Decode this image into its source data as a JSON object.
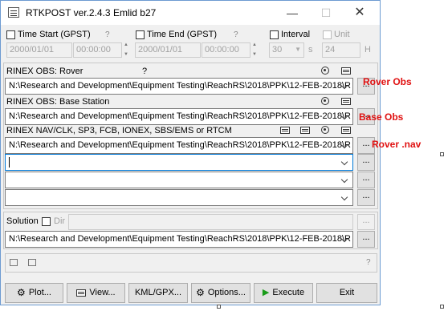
{
  "window": {
    "title": "RTKPOST ver.2.4.3 Emlid b27"
  },
  "time_start": {
    "label": "Time Start (GPST)",
    "date": "2000/01/01",
    "time": "00:00:00",
    "help": "?"
  },
  "time_end": {
    "label": "Time End (GPST)",
    "date": "2000/01/01",
    "time": "00:00:00",
    "help": "?"
  },
  "interval": {
    "label": "Interval",
    "value": "30",
    "unit_suffix": "s"
  },
  "unit": {
    "label": "Unit",
    "value": "24",
    "unit_suffix": "H"
  },
  "rinex_rover": {
    "label": "RINEX OBS: Rover",
    "help": "?",
    "path": "N:\\Research and Development\\Equipment Testing\\ReachRS\\2018\\PPK\\12-FEB-2018\\R"
  },
  "rinex_base": {
    "label": "RINEX OBS: Base Station",
    "path": "N:\\Research and Development\\Equipment Testing\\ReachRS\\2018\\PPK\\12-FEB-2018\\R"
  },
  "rinex_nav": {
    "label": "RINEX NAV/CLK, SP3, FCB, IONEX, SBS/EMS  or RTCM",
    "path": "N:\\Research and Development\\Equipment Testing\\ReachRS\\2018\\PPK\\12-FEB-2018\\R"
  },
  "extra_files": [
    "",
    "",
    ""
  ],
  "solution": {
    "label": "Solution",
    "dir_label": "Dir",
    "path": "N:\\Research and Development\\Equipment Testing\\ReachRS\\2018\\PPK\\12-FEB-2018\\R"
  },
  "status": {
    "help": "?"
  },
  "browse_label": "...",
  "buttons": {
    "plot": "Plot...",
    "view": "View...",
    "kml": "KML/GPX...",
    "options": "Options...",
    "execute": "Execute",
    "exit": "Exit"
  },
  "annotations": {
    "rover_obs": "Rover Obs",
    "base_obs": "Base Obs",
    "rover_nav": "Rover .nav"
  },
  "colors": {
    "annotation": "#e01010",
    "execute_icon": "#1a9c1a",
    "window_border": "#6d9bd1"
  }
}
